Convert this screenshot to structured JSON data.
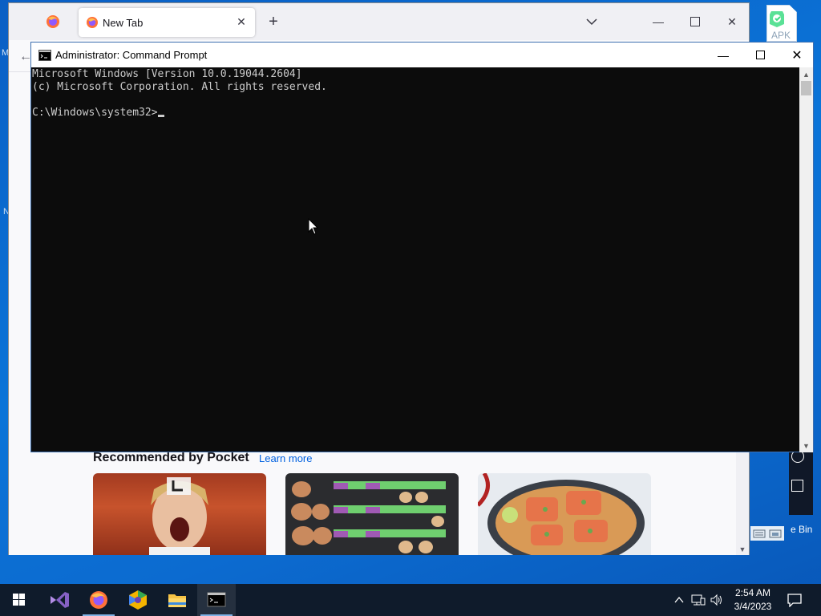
{
  "desktop": {
    "apk_icon_label": "APK",
    "left_letters": [
      "M",
      "N"
    ],
    "recycle_bin_partial_label": "e Bin"
  },
  "firefox": {
    "active_tab_title": "New Tab",
    "pocket_heading": "Recommended by Pocket",
    "pocket_learn_more": "Learn more",
    "cards": [
      {
        "subject": "screaming-person-photo"
      },
      {
        "subject": "egg-cartons-photo"
      },
      {
        "subject": "salmon-dish-photo"
      }
    ]
  },
  "cmd": {
    "title": "Administrator:  Command Prompt",
    "lines": [
      "Microsoft Windows [Version 10.0.19044.2604]",
      "(c) Microsoft Corporation. All rights reserved.",
      "",
      "C:\\Windows\\system32>"
    ]
  },
  "taskbar": {
    "apps": [
      "start-button",
      "visual-studio",
      "firefox",
      "app-hex",
      "file-explorer",
      "command-prompt"
    ],
    "time": "2:54 AM",
    "date": "3/4/2023"
  },
  "colors": {
    "desktop_blue": "#0b74d8",
    "taskbar": "#0f1b2b",
    "cmd_bg": "#0c0c0c",
    "cmd_text": "#cccccc",
    "link": "#0061e0"
  }
}
